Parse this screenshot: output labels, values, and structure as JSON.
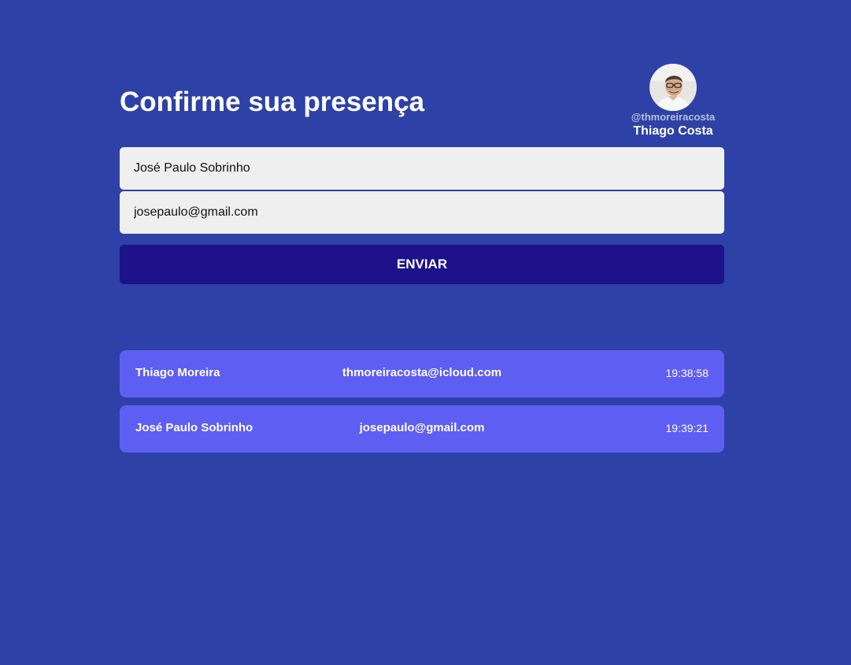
{
  "page": {
    "title": "Confirme sua presença"
  },
  "profile": {
    "handle": "@thmoreiracosta",
    "name": "Thiago Costa"
  },
  "form": {
    "name_value": "José Paulo Sobrinho",
    "email_value": "josepaulo@gmail.com",
    "submit_label": "ENVIAR"
  },
  "guests": [
    {
      "name": "Thiago Moreira",
      "email": "thmoreiracosta@icloud.com",
      "time": "19:38:58"
    },
    {
      "name": "José Paulo Sobrinho",
      "email": "josepaulo@gmail.com",
      "time": "19:39:21"
    }
  ],
  "colors": {
    "background": "#2e41a6",
    "input_bg": "#efefef",
    "button_bg": "#1d128a",
    "row_bg": "#5f5ef2"
  }
}
